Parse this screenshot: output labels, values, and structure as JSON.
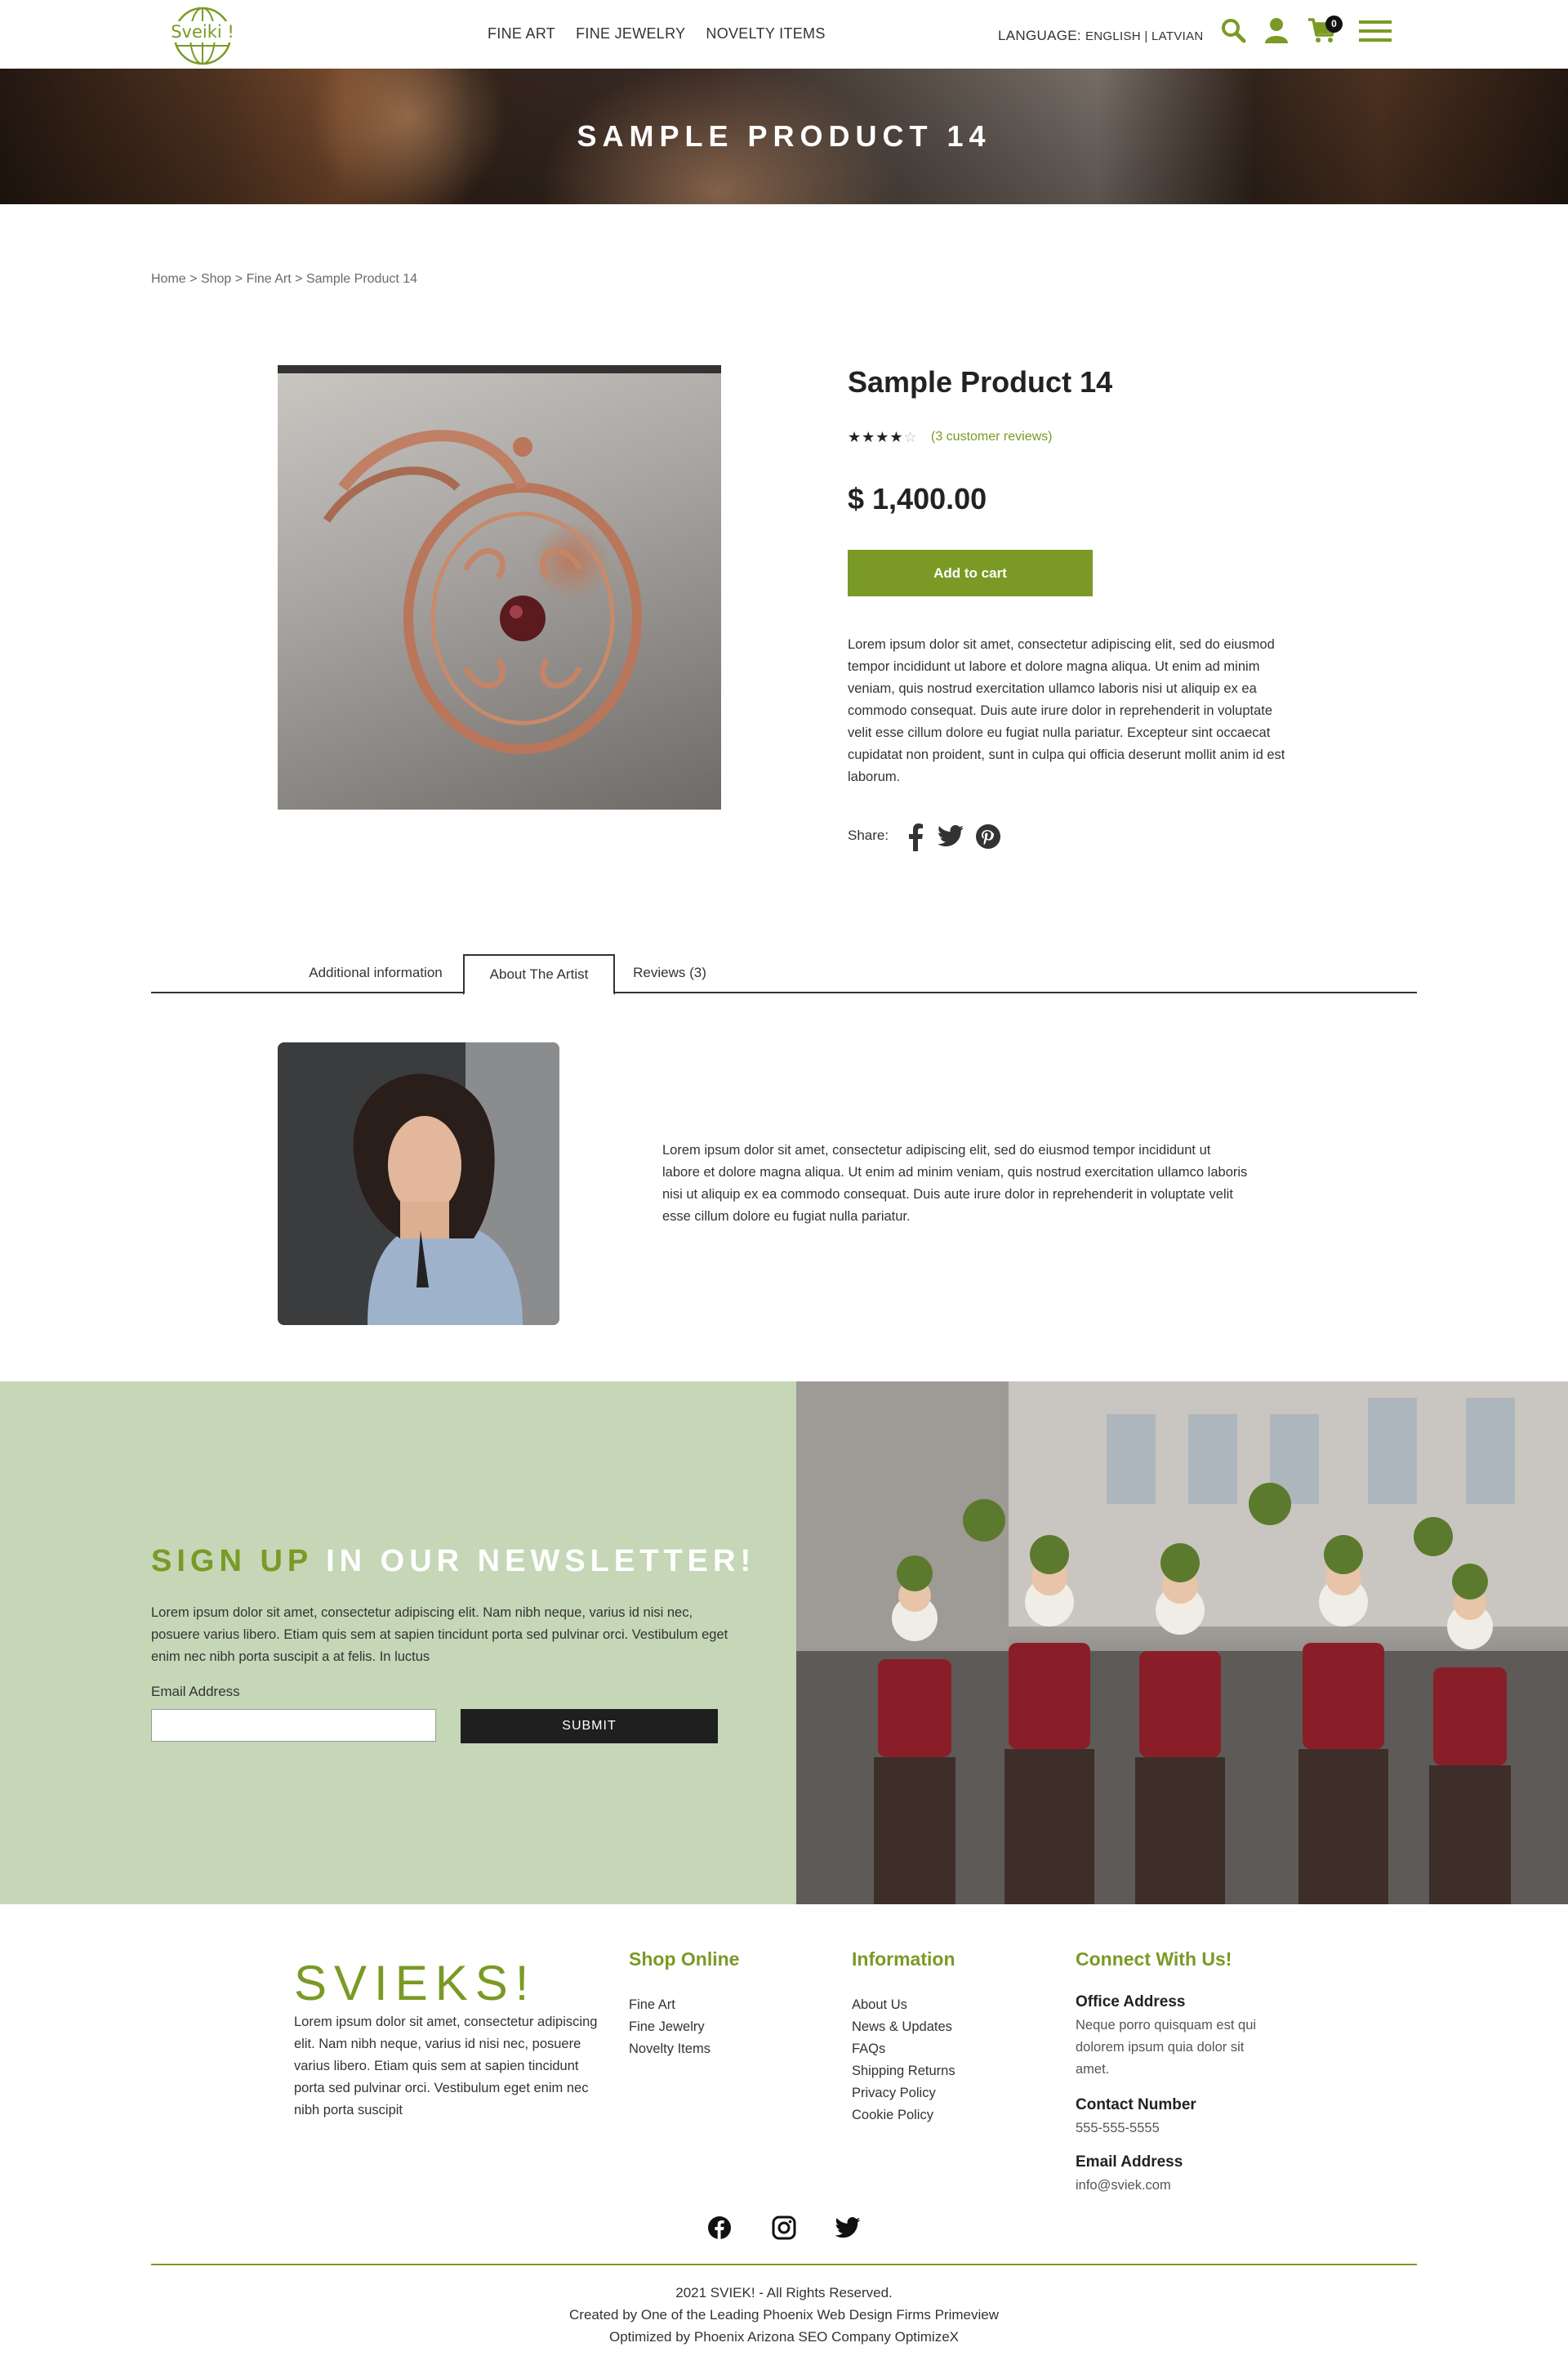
{
  "header": {
    "logo_text": "Sveiki !",
    "nav": [
      "FINE ART",
      "FINE JEWELRY",
      "NOVELTY ITEMS"
    ],
    "language_label": "LANGUAGE:",
    "language_options": "ENGLISH | LATVIAN",
    "cart_count": "0",
    "icons": [
      "search-icon",
      "user-icon",
      "cart-icon",
      "menu-icon"
    ],
    "accent_color": "#7a9a25"
  },
  "hero": {
    "title": "SAMPLE PRODUCT 14"
  },
  "breadcrumb": {
    "home": "Home",
    "shop": "Shop",
    "category": "Fine Art",
    "current": "Sample Product 14",
    "separator": ">"
  },
  "product": {
    "title": "Sample Product 14",
    "rating": 4,
    "rating_max": 5,
    "stars_filled": "★★★★",
    "stars_empty": "☆",
    "reviews_link": "(3 customer reviews)",
    "price": "$ 1,400.00",
    "add_to_cart": "Add to cart",
    "description": "Lorem ipsum dolor sit amet, consectetur adipiscing elit, sed do eiusmod tempor incididunt ut labore et dolore magna aliqua. Ut enim ad minim veniam, quis nostrud exercitation ullamco laboris nisi ut aliquip ex ea commodo consequat. Duis aute irure dolor in reprehenderit in voluptate velit esse cillum dolore eu fugiat nulla pariatur. Excepteur sint occaecat cupidatat non proident, sunt in culpa qui officia deserunt mollit anim id est laborum.",
    "share_label": "Share:"
  },
  "tabs": {
    "items": [
      "Additional information",
      "About The Artist",
      "Reviews (3)"
    ],
    "active": "About The Artist"
  },
  "artist": {
    "text": "Lorem ipsum dolor sit amet, consectetur adipiscing elit, sed do eiusmod tempor incididunt ut labore et dolore magna aliqua. Ut enim ad minim veniam, quis nostrud exercitation ullamco laboris nisi ut aliquip ex ea commodo consequat. Duis aute irure dolor in reprehenderit in voluptate velit esse cillum dolore eu fugiat nulla pariatur."
  },
  "newsletter": {
    "title_green": "SIGN UP",
    "title_white": "IN OUR NEWSLETTER!",
    "text": "Lorem ipsum dolor sit amet, consectetur adipiscing elit. Nam nibh neque, varius id nisi nec, posuere varius libero. Etiam quis sem at sapien tincidunt porta sed pulvinar orci. Vestibulum eget enim nec nibh porta suscipit a at felis. In luctus",
    "email_label": "Email Address",
    "email_value": "",
    "submit": "SUBMIT",
    "bg_color": "#c5d7b6"
  },
  "footer": {
    "logo": "SVIEKS!",
    "about": "Lorem ipsum dolor sit amet, consectetur adipiscing elit. Nam nibh neque, varius id nisi nec, posuere varius libero. Etiam quis sem at sapien tincidunt porta sed pulvinar orci. Vestibulum eget enim nec nibh porta suscipit",
    "shop": {
      "title": "Shop Online",
      "items": [
        "Fine Art",
        "Fine Jewelry",
        "Novelty Items"
      ]
    },
    "info": {
      "title": "Information",
      "items": [
        "About Us",
        "News & Updates",
        "FAQs",
        "Shipping Returns",
        "Privacy Policy",
        "Cookie Policy"
      ]
    },
    "connect": {
      "title": "Connect With Us!",
      "office_label": "Office Address",
      "office_value": "Neque porro quisquam est qui dolorem ipsum quia dolor sit amet.",
      "phone_label": "Contact Number",
      "phone_value": "555-555-5555",
      "email_label": "Email Address",
      "email_value": "info@sviek.com"
    },
    "social": [
      "facebook-icon",
      "instagram-icon",
      "twitter-icon"
    ],
    "copyright": "2021 SVIEK! - All Rights Reserved.",
    "credit1": "Created by One of the Leading Phoenix Web Design Firms Primeview",
    "credit2": "Optimized by Phoenix Arizona SEO Company OptimizeX"
  }
}
